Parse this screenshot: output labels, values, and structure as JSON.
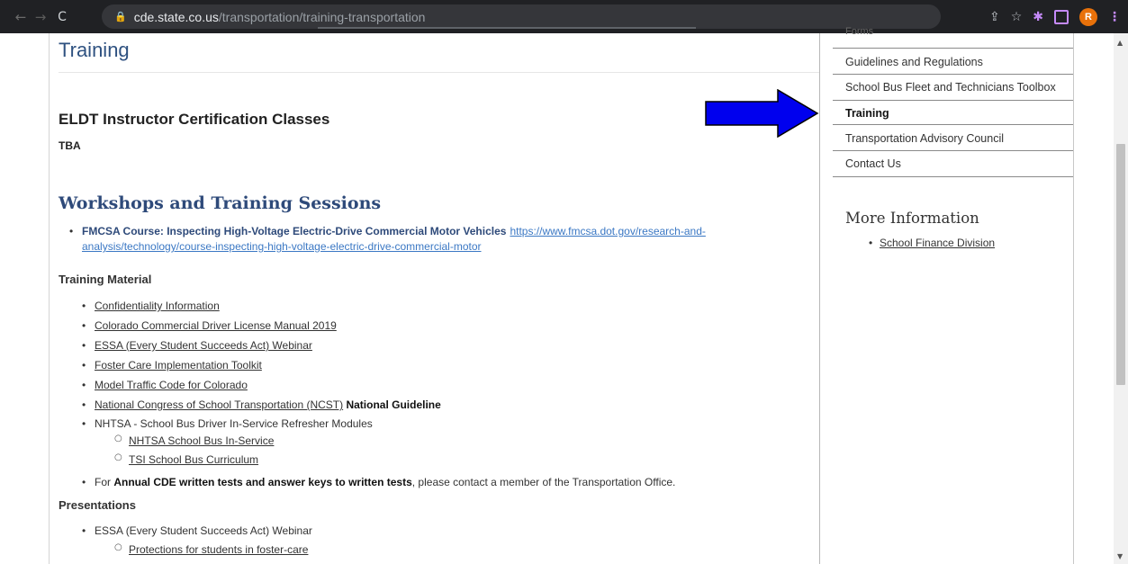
{
  "browser": {
    "url_host": "cde.state.co.us",
    "url_path": "/transportation/training-transportation",
    "profile_initial": "R"
  },
  "main": {
    "title": "Training",
    "eldt_heading": "ELDT Instructor Certification Classes",
    "eldt_status": "TBA",
    "workshops_heading": "Workshops and Training Sessions",
    "fmcsa_label": "FMCSA Course: Inspecting High-Voltage Electric-Drive Commercial Motor Vehicles",
    "fmcsa_link": "https://www.fmcsa.dot.gov/research-and-analysis/technology/course-inspecting-high-voltage-electric-drive-commercial-motor",
    "material_heading": "Training Material",
    "material_items": [
      "Confidentiality Information",
      "Colorado Commercial Driver License Manual 2019",
      "ESSA (Every Student Succeeds Act) Webinar",
      "Foster Care Implementation Toolkit",
      "Model Traffic Code for Colorado",
      "National Congress of School Transportation (NCST)"
    ],
    "ncst_suffix": "National Guideline",
    "nhtsa_label": "NHTSA - School Bus Driver In-Service Refresher Modules",
    "nhtsa_sub": [
      "NHTSA School Bus In-Service",
      "TSI School Bus Curriculum"
    ],
    "annual_prefix": "For",
    "annual_bold": "Annual CDE written tests and answer keys to written tests",
    "annual_suffix": ", please contact a member of the Transportation Office.",
    "presentations_heading": "Presentations",
    "presentations_item": "ESSA (Every Student Succeeds Act) Webinar",
    "presentations_sub": "Protections for students in foster-care"
  },
  "sidebar": {
    "items": [
      "Forms",
      "Guidelines and Regulations",
      "School Bus Fleet and Technicians Toolbox",
      "Training",
      "Transportation Advisory Council",
      "Contact Us"
    ],
    "active_index": 3,
    "more_info_heading": "More Information",
    "more_info_link": "School Finance Division"
  },
  "colors": {
    "arrow": "#0000ee",
    "title": "#2e5180",
    "link_blue": "#3b78c4"
  }
}
